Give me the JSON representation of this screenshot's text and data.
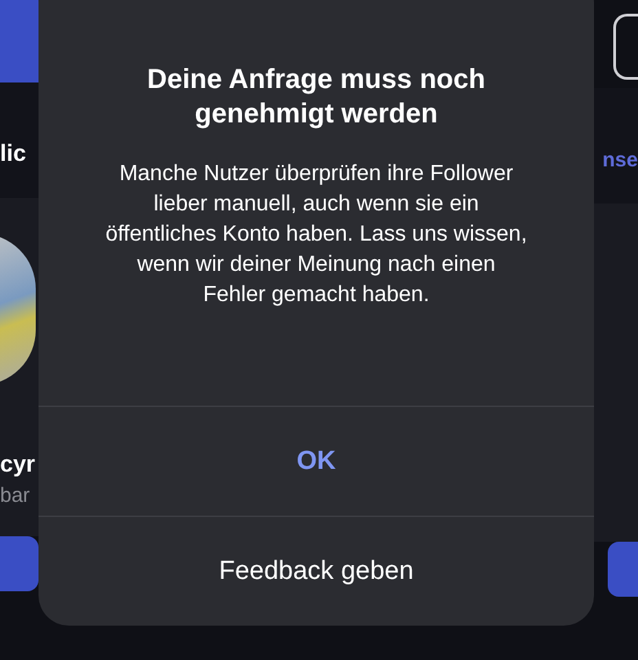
{
  "background": {
    "left_texts": [
      {
        "text": "lic",
        "kind": "heading"
      },
      {
        "text": "cyr",
        "kind": "name"
      },
      {
        "text": "bar",
        "kind": "sub"
      }
    ],
    "right_texts": [
      {
        "text": "nse",
        "kind": "link"
      }
    ]
  },
  "dialog": {
    "title": "Deine Anfrage muss noch genehmigt werden",
    "message": "Manche Nutzer überprüfen ihre Follower lieber manuell, auch wenn sie ein öffentliches Konto haben. Lass uns wissen, wenn wir deiner Meinung nach einen Fehler gemacht haben.",
    "actions": [
      {
        "label": "OK",
        "kind": "primary"
      },
      {
        "label": "Feedback geben",
        "kind": "secondary"
      }
    ]
  }
}
